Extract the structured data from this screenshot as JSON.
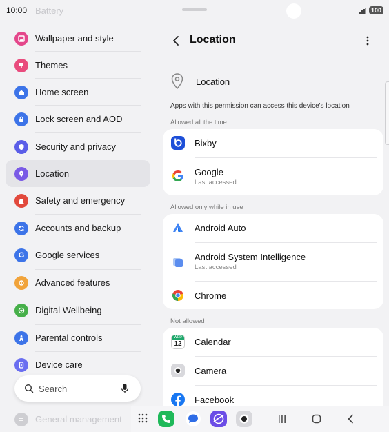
{
  "status": {
    "time": "10:00",
    "battery": "100"
  },
  "left_menu": {
    "partial_top": "Battery",
    "items": [
      {
        "label": "Wallpaper and style",
        "icon": "wallpaper-icon",
        "color": "#e4478b"
      },
      {
        "label": "Themes",
        "icon": "themes-icon",
        "color": "#e94b7d"
      },
      {
        "label": "Home screen",
        "icon": "home-icon",
        "color": "#3d74e8"
      },
      {
        "label": "Lock screen and AOD",
        "icon": "lock-icon",
        "color": "#3d74e8"
      },
      {
        "label": "Security and privacy",
        "icon": "shield-icon",
        "color": "#5b5ee8"
      },
      {
        "label": "Location",
        "icon": "location-pin-icon",
        "color": "#7a5ae6"
      },
      {
        "label": "Safety and emergency",
        "icon": "safety-icon",
        "color": "#e2493c"
      },
      {
        "label": "Accounts and backup",
        "icon": "sync-icon",
        "color": "#3d74e8"
      },
      {
        "label": "Google services",
        "icon": "google-g-icon",
        "color": "#3d74e8"
      },
      {
        "label": "Advanced features",
        "icon": "gear-plus-icon",
        "color": "#f1a33a"
      },
      {
        "label": "Digital Wellbeing",
        "icon": "wellbeing-icon",
        "color": "#47b04a"
      },
      {
        "label": "Parental controls",
        "icon": "parental-icon",
        "color": "#3d74e8"
      },
      {
        "label": "Device care",
        "icon": "device-care-icon",
        "color": "#6a6ef0"
      }
    ],
    "partial_bottom": "General management"
  },
  "search": {
    "label": "Search"
  },
  "location_page": {
    "title": "Location",
    "location_row": "Location",
    "info": "Apps with this permission can access this device's location",
    "sections": [
      {
        "header": "Allowed all the time",
        "apps": [
          {
            "name": "Bixby",
            "sub": ""
          },
          {
            "name": "Google",
            "sub": "Last accessed"
          }
        ]
      },
      {
        "header": "Allowed only while in use",
        "apps": [
          {
            "name": "Android Auto",
            "sub": ""
          },
          {
            "name": "Android System Intelligence",
            "sub": "Last accessed"
          },
          {
            "name": "Chrome",
            "sub": ""
          }
        ]
      },
      {
        "header": "Not allowed",
        "apps": [
          {
            "name": "Calendar",
            "sub": ""
          },
          {
            "name": "Camera",
            "sub": ""
          },
          {
            "name": "Facebook",
            "sub": ""
          }
        ]
      }
    ],
    "calendar_icon": {
      "day": "WED",
      "date": "12"
    }
  }
}
